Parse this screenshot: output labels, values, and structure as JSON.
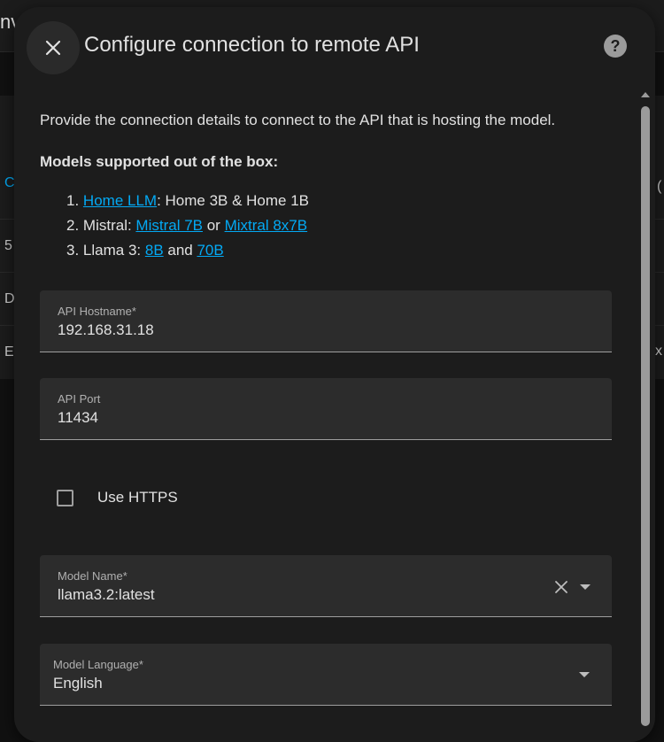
{
  "background": {
    "title_fragment": "nv",
    "left_letters": [
      "C",
      "5",
      "D",
      "E"
    ],
    "right_letters": [
      "(",
      "x"
    ]
  },
  "dialog": {
    "title": "Configure connection to remote API",
    "close_icon": "close-icon",
    "help_icon": "help-icon",
    "help_glyph": "?",
    "description": "Provide the connection details to connect to the API that is hosting the model.",
    "models_heading": "Models supported out of the box:",
    "models": [
      {
        "number": "1.",
        "link1": "Home LLM",
        "text1": ": Home 3B & Home 1B"
      },
      {
        "number": "2.",
        "prefix": "Mistral: ",
        "link1": "Mistral 7B",
        "mid": " or ",
        "link2": "Mixtral 8x7B"
      },
      {
        "number": "3.",
        "prefix": "Llama 3: ",
        "link1": "8B",
        "mid": " and ",
        "link2": "70B"
      }
    ],
    "fields": {
      "api_hostname": {
        "label": "API Hostname*",
        "value": "192.168.31.18"
      },
      "api_port": {
        "label": "API Port",
        "value": "11434"
      },
      "use_https": {
        "label": "Use HTTPS",
        "checked": false
      },
      "model_name": {
        "label": "Model Name*",
        "value": "llama3.2:latest"
      },
      "model_language": {
        "label": "Model Language*",
        "value": "English"
      }
    }
  },
  "colors": {
    "accent_link": "#03a9f4",
    "dialog_bg": "#1c1c1c",
    "field_bg": "#2c2c2c"
  }
}
